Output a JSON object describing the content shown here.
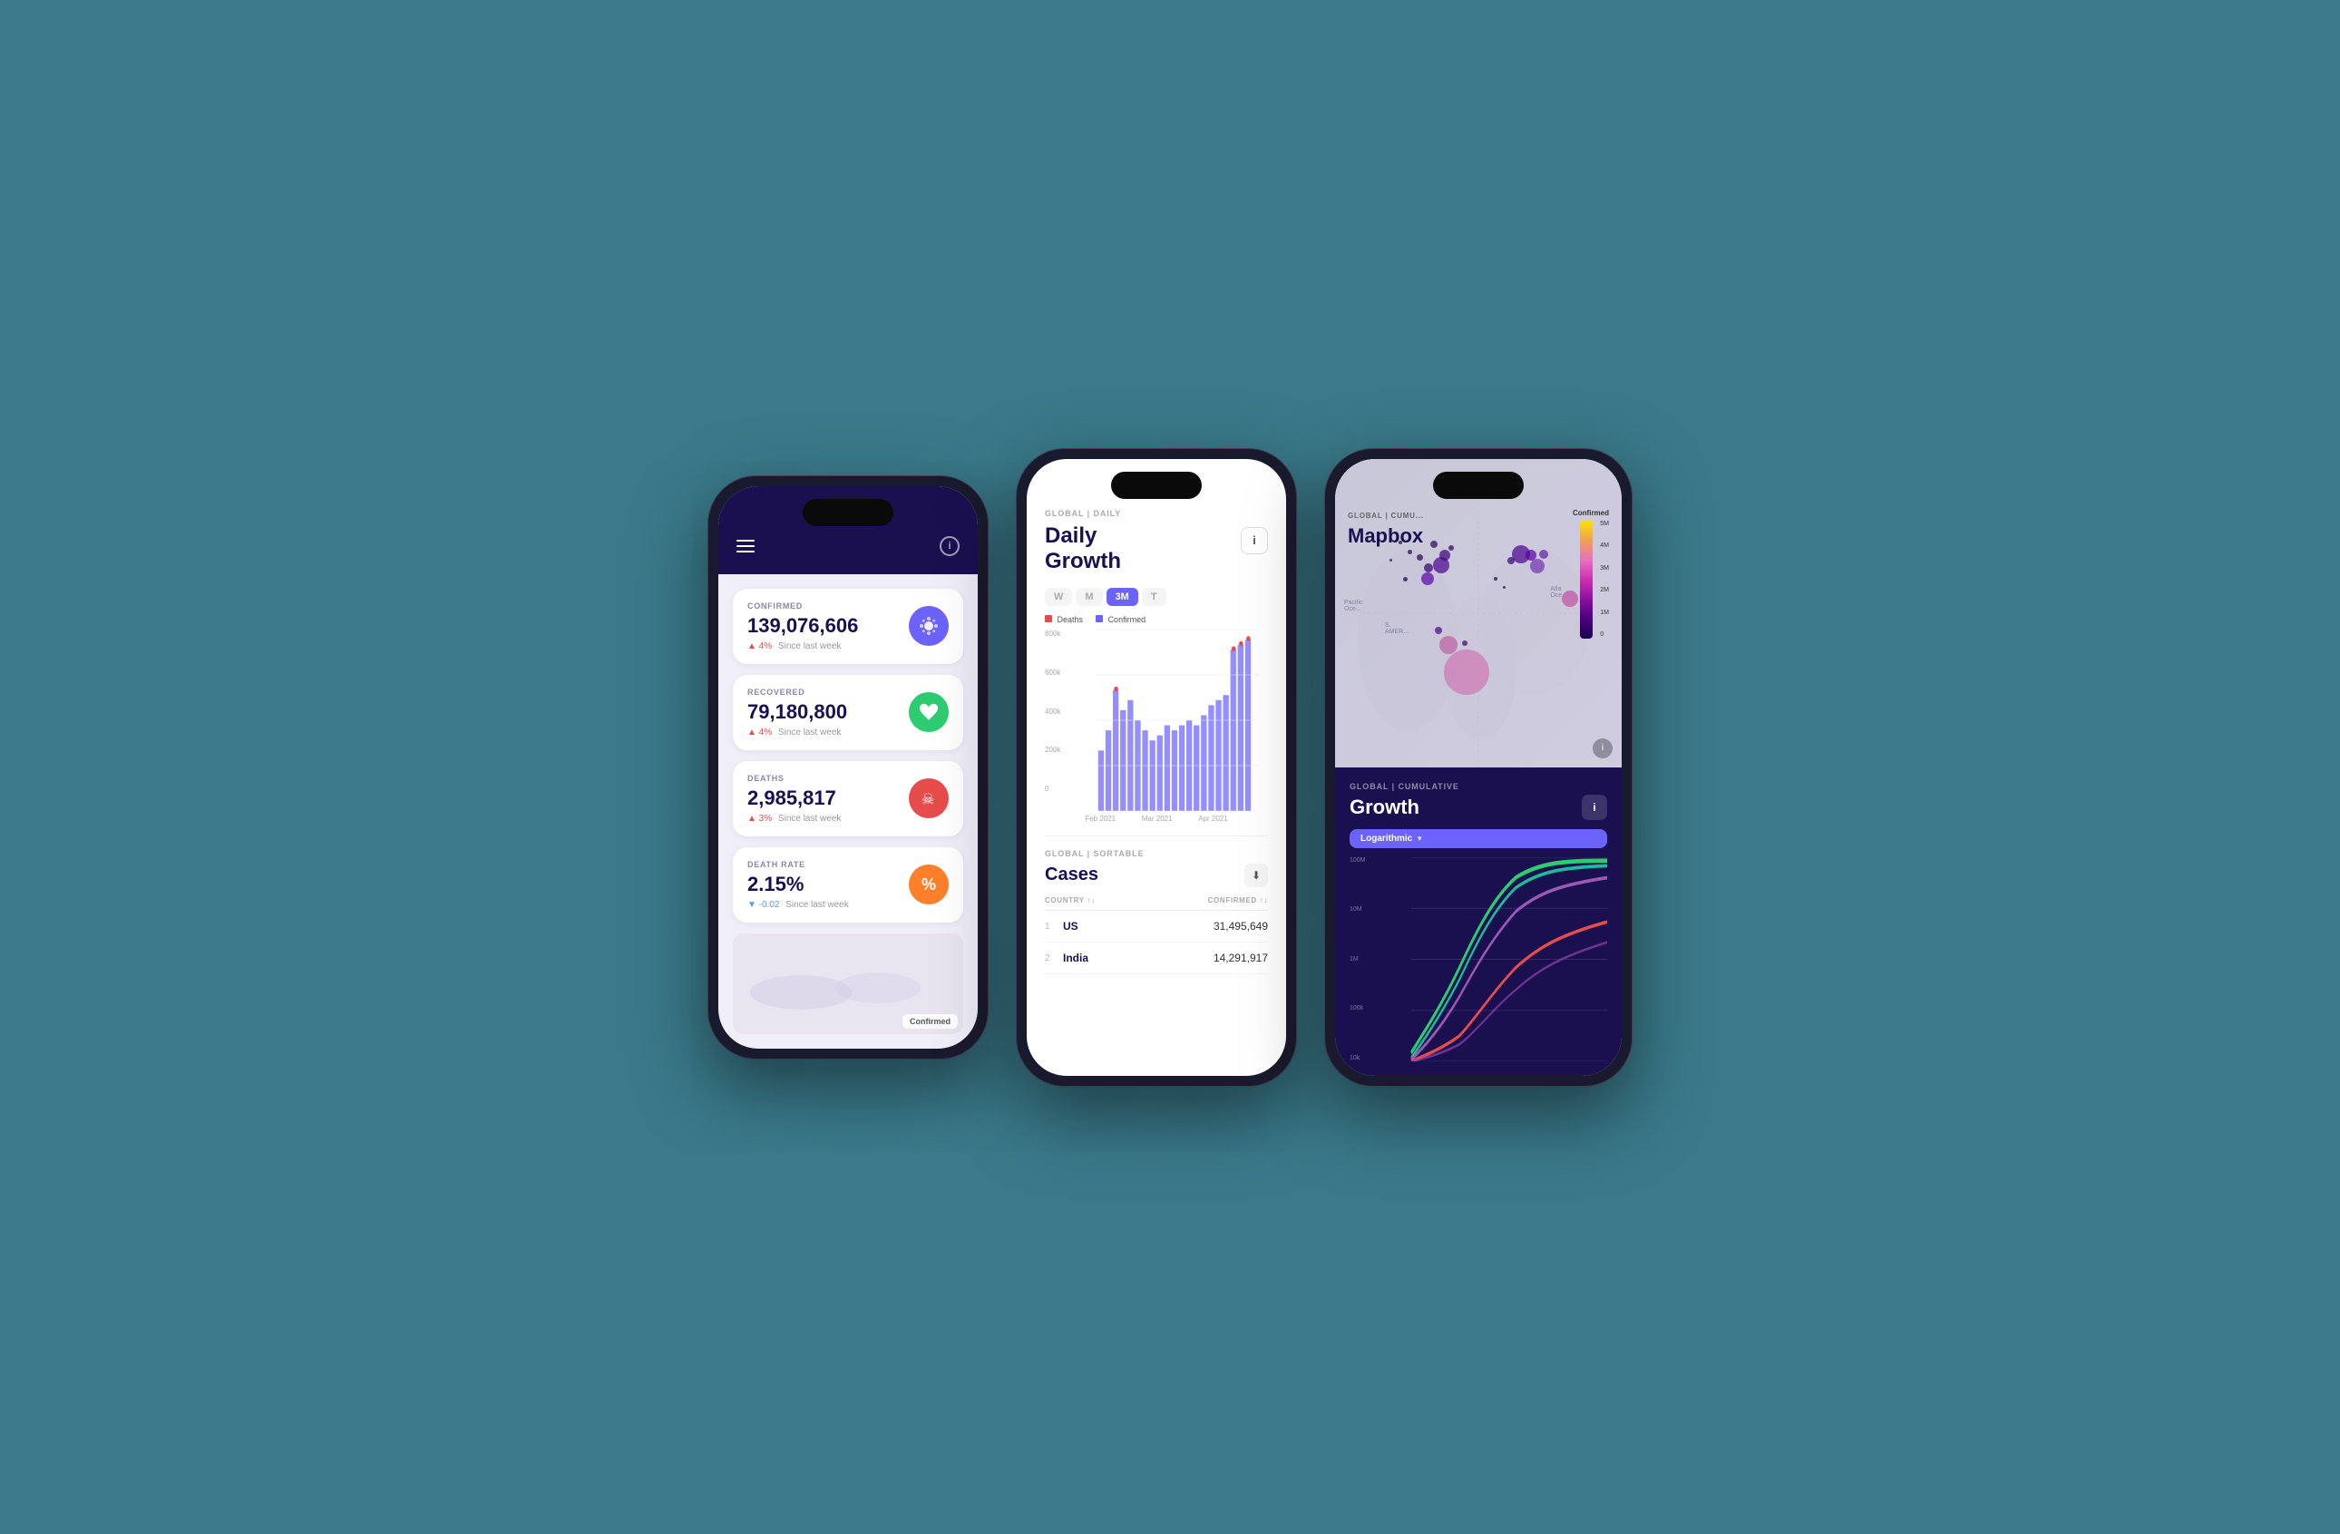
{
  "background": "#3a7a8a",
  "phone1": {
    "stats": [
      {
        "label": "CONFIRMED",
        "value": "139,076,606",
        "change": "▲ 4%",
        "change_text": "Since last week",
        "change_type": "up",
        "icon": "🦠",
        "icon_class": "icon-confirmed"
      },
      {
        "label": "RECOVERED",
        "value": "79,180,800",
        "change": "▲ 4%",
        "change_text": "Since last week",
        "change_type": "up",
        "icon": "💚",
        "icon_class": "icon-recovered"
      },
      {
        "label": "DEATHS",
        "value": "2,985,817",
        "change": "▲ 3%",
        "change_text": "Since last week",
        "change_type": "up",
        "icon": "☠",
        "icon_class": "icon-deaths"
      },
      {
        "label": "DEATH RATE",
        "value": "2.15%",
        "change": "▼ -0.02",
        "change_text": "Since last week",
        "change_type": "down",
        "icon": "%",
        "icon_class": "icon-rate"
      }
    ],
    "map_confirmed_label": "Confirmed"
  },
  "phone2": {
    "breadcrumb": "GLOBAL | DAILY",
    "title": "Daily\nGrowth",
    "info_label": "i",
    "time_tabs": [
      "W",
      "M",
      "3M",
      "T"
    ],
    "active_tab": "3M",
    "legend": [
      {
        "color": "#e74c4c",
        "label": "Deaths"
      },
      {
        "color": "#6c63ff",
        "label": "Confirmed"
      }
    ],
    "chart_y_labels": [
      "800k",
      "600k",
      "400k",
      "200k",
      "0"
    ],
    "chart_x_labels": [
      "Feb 2021",
      "Mar 2021",
      "Apr 2021"
    ],
    "cases_breadcrumb": "GLOBAL | SORTABLE",
    "cases_title": "Cases",
    "table_cols": [
      "COUNTRY ↑↓",
      "CONFIRMED ↑↓"
    ],
    "table_rows": [
      {
        "rank": "1",
        "country": "US",
        "confirmed": "31,495,649"
      },
      {
        "rank": "2",
        "country": "India",
        "confirmed": "14,291,917"
      }
    ]
  },
  "phone3": {
    "map_breadcrumb": "GLOBAL | CUMU...",
    "map_title": "Mapbox",
    "map_label_americas": "AMER...",
    "map_label_pacific": "Pacific\nOce...",
    "map_label_atlantic": "Atla\nOce...",
    "map_legend_title": "Confirmed",
    "map_legend_labels": [
      "5M",
      "4M",
      "3M",
      "2M",
      "1M",
      "0"
    ],
    "growth_breadcrumb": "GLOBAL | CUMULATIVE",
    "growth_title": "Growth",
    "logarithmic_label": "Logarithmic",
    "growth_y_labels": [
      "100M",
      "10M",
      "1M",
      "100k",
      "10k"
    ],
    "info_label": "i"
  }
}
